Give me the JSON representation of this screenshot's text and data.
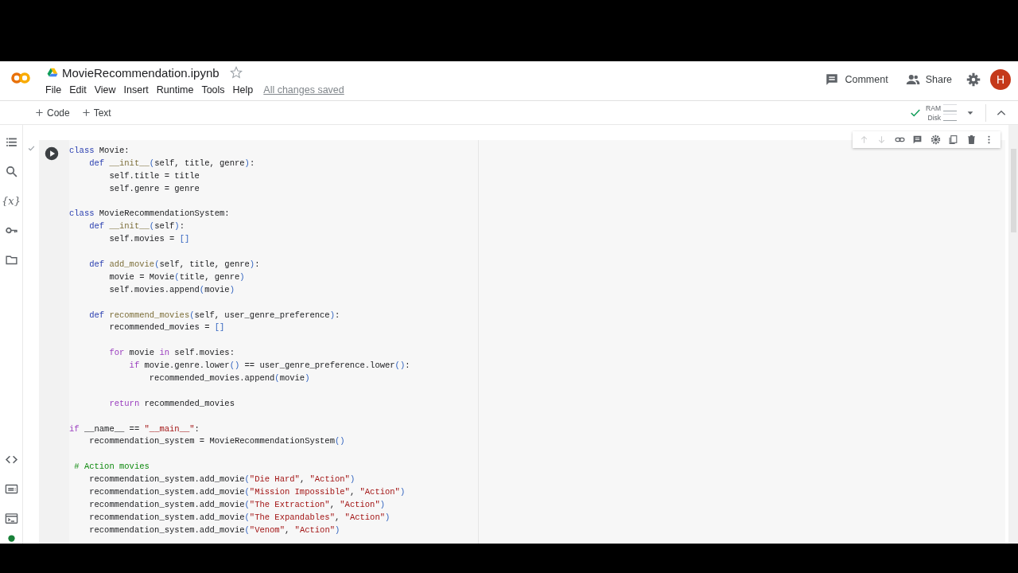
{
  "header": {
    "notebook_title": "MovieRecommendation.ipynb",
    "starred": false,
    "menu": [
      "File",
      "Edit",
      "View",
      "Insert",
      "Runtime",
      "Tools",
      "Help"
    ],
    "save_status": "All changes saved",
    "comment_label": "Comment",
    "share_label": "Share",
    "avatar_initial": "H"
  },
  "toolbar": {
    "add_buttons": [
      "Code",
      "Text"
    ],
    "resources": {
      "connected": true,
      "ram_label": "RAM",
      "disk_label": "Disk"
    }
  },
  "sidebar_items": [
    {
      "kind": "toc"
    },
    {
      "kind": "search"
    },
    {
      "kind": "variables",
      "glyph": "{x}"
    },
    {
      "kind": "secrets"
    },
    {
      "kind": "files"
    },
    {
      "kind": "snippets"
    },
    {
      "kind": "palette"
    },
    {
      "kind": "terminal"
    }
  ],
  "cell": {
    "executed": true,
    "toolbar": [
      {
        "kind": "up",
        "disabled": true
      },
      {
        "kind": "down",
        "disabled": true
      },
      {
        "kind": "link",
        "disabled": false
      },
      {
        "kind": "comment",
        "disabled": false
      },
      {
        "kind": "settings",
        "disabled": false
      },
      {
        "kind": "mirror",
        "disabled": false
      },
      {
        "kind": "delete",
        "disabled": false
      },
      {
        "kind": "more",
        "disabled": false
      }
    ],
    "lines": [
      {
        "kind": "code",
        "tokens": [
          {
            "kind": "kw",
            "text": "class"
          },
          {
            "kind": "p",
            "text": " Movie:"
          }
        ]
      },
      {
        "kind": "code",
        "tokens": [
          {
            "kind": "kw",
            "text": "    def"
          },
          {
            "kind": "fn",
            "text": " __init__"
          },
          {
            "kind": "br",
            "text": "("
          },
          {
            "kind": "p",
            "text": "self, title, genre"
          },
          {
            "kind": "br",
            "text": ")"
          },
          {
            "kind": "p",
            "text": ":"
          }
        ]
      },
      {
        "kind": "code",
        "tokens": [
          {
            "kind": "p",
            "text": "        self.title = title"
          }
        ]
      },
      {
        "kind": "code",
        "tokens": [
          {
            "kind": "p",
            "text": "        self.genre = genre"
          }
        ]
      },
      {
        "kind": "blank"
      },
      {
        "kind": "code",
        "tokens": [
          {
            "kind": "kw",
            "text": "class"
          },
          {
            "kind": "p",
            "text": " MovieRecommendationSystem:"
          }
        ]
      },
      {
        "kind": "code",
        "tokens": [
          {
            "kind": "kw",
            "text": "    def"
          },
          {
            "kind": "fn",
            "text": " __init__"
          },
          {
            "kind": "br",
            "text": "("
          },
          {
            "kind": "p",
            "text": "self"
          },
          {
            "kind": "br",
            "text": ")"
          },
          {
            "kind": "p",
            "text": ":"
          }
        ]
      },
      {
        "kind": "code",
        "tokens": [
          {
            "kind": "p",
            "text": "        self.movies = "
          },
          {
            "kind": "br",
            "text": "[]"
          }
        ]
      },
      {
        "kind": "blank"
      },
      {
        "kind": "code",
        "tokens": [
          {
            "kind": "kw",
            "text": "    def"
          },
          {
            "kind": "fn",
            "text": " add_movie"
          },
          {
            "kind": "br",
            "text": "("
          },
          {
            "kind": "p",
            "text": "self, title, genre"
          },
          {
            "kind": "br",
            "text": ")"
          },
          {
            "kind": "p",
            "text": ":"
          }
        ]
      },
      {
        "kind": "code",
        "tokens": [
          {
            "kind": "p",
            "text": "        movie = Movie"
          },
          {
            "kind": "br",
            "text": "("
          },
          {
            "kind": "p",
            "text": "title, genre"
          },
          {
            "kind": "br",
            "text": ")"
          }
        ]
      },
      {
        "kind": "code",
        "tokens": [
          {
            "kind": "p",
            "text": "        self.movies.append"
          },
          {
            "kind": "br",
            "text": "("
          },
          {
            "kind": "p",
            "text": "movie"
          },
          {
            "kind": "br",
            "text": ")"
          }
        ]
      },
      {
        "kind": "blank"
      },
      {
        "kind": "code",
        "tokens": [
          {
            "kind": "kw",
            "text": "    def"
          },
          {
            "kind": "fn",
            "text": " recommend_movies"
          },
          {
            "kind": "br",
            "text": "("
          },
          {
            "kind": "p",
            "text": "self, user_genre_preference"
          },
          {
            "kind": "br",
            "text": ")"
          },
          {
            "kind": "p",
            "text": ":"
          }
        ]
      },
      {
        "kind": "code",
        "tokens": [
          {
            "kind": "p",
            "text": "        recommended_movies = "
          },
          {
            "kind": "br",
            "text": "[]"
          }
        ]
      },
      {
        "kind": "blank"
      },
      {
        "kind": "code",
        "tokens": [
          {
            "kind": "ctl",
            "text": "        for"
          },
          {
            "kind": "p",
            "text": " movie "
          },
          {
            "kind": "ctl",
            "text": "in"
          },
          {
            "kind": "p",
            "text": " self.movies:"
          }
        ]
      },
      {
        "kind": "code",
        "tokens": [
          {
            "kind": "ctl",
            "text": "            if"
          },
          {
            "kind": "p",
            "text": " movie.genre.lower"
          },
          {
            "kind": "br",
            "text": "()"
          },
          {
            "kind": "p",
            "text": " == user_genre_preference.lower"
          },
          {
            "kind": "br",
            "text": "()"
          },
          {
            "kind": "p",
            "text": ":"
          }
        ]
      },
      {
        "kind": "code",
        "tokens": [
          {
            "kind": "p",
            "text": "                recommended_movies.append"
          },
          {
            "kind": "br",
            "text": "("
          },
          {
            "kind": "p",
            "text": "movie"
          },
          {
            "kind": "br",
            "text": ")"
          }
        ]
      },
      {
        "kind": "blank"
      },
      {
        "kind": "code",
        "tokens": [
          {
            "kind": "ctl",
            "text": "        return"
          },
          {
            "kind": "p",
            "text": " recommended_movies"
          }
        ]
      },
      {
        "kind": "blank"
      },
      {
        "kind": "code",
        "tokens": [
          {
            "kind": "ctl",
            "text": "if"
          },
          {
            "kind": "p",
            "text": " __name__ == "
          },
          {
            "kind": "str",
            "text": "\"__main__\""
          },
          {
            "kind": "p",
            "text": ":"
          }
        ]
      },
      {
        "kind": "code",
        "tokens": [
          {
            "kind": "p",
            "text": "    recommendation_system = MovieRecommendationSystem"
          },
          {
            "kind": "br",
            "text": "()"
          }
        ]
      },
      {
        "kind": "blank"
      },
      {
        "kind": "code",
        "tokens": [
          {
            "kind": "com",
            "text": " # Action movies"
          }
        ]
      },
      {
        "kind": "code",
        "tokens": [
          {
            "kind": "p",
            "text": "    recommendation_system.add_movie"
          },
          {
            "kind": "br",
            "text": "("
          },
          {
            "kind": "str",
            "text": "\"Die Hard\""
          },
          {
            "kind": "p",
            "text": ", "
          },
          {
            "kind": "str",
            "text": "\"Action\""
          },
          {
            "kind": "br",
            "text": ")"
          }
        ]
      },
      {
        "kind": "code",
        "tokens": [
          {
            "kind": "p",
            "text": "    recommendation_system.add_movie"
          },
          {
            "kind": "br",
            "text": "("
          },
          {
            "kind": "str",
            "text": "\"Mission Impossible\""
          },
          {
            "kind": "p",
            "text": ", "
          },
          {
            "kind": "str",
            "text": "\"Action\""
          },
          {
            "kind": "br",
            "text": ")"
          }
        ]
      },
      {
        "kind": "code",
        "tokens": [
          {
            "kind": "p",
            "text": "    recommendation_system.add_movie"
          },
          {
            "kind": "br",
            "text": "("
          },
          {
            "kind": "str",
            "text": "\"The Extraction\""
          },
          {
            "kind": "p",
            "text": ", "
          },
          {
            "kind": "str",
            "text": "\"Action\""
          },
          {
            "kind": "br",
            "text": ")"
          }
        ]
      },
      {
        "kind": "code",
        "tokens": [
          {
            "kind": "p",
            "text": "    recommendation_system.add_movie"
          },
          {
            "kind": "br",
            "text": "("
          },
          {
            "kind": "str",
            "text": "\"The Expandables\""
          },
          {
            "kind": "p",
            "text": ", "
          },
          {
            "kind": "str",
            "text": "\"Action\""
          },
          {
            "kind": "br",
            "text": ")"
          }
        ]
      },
      {
        "kind": "code",
        "tokens": [
          {
            "kind": "p",
            "text": "    recommendation_system.add_movie"
          },
          {
            "kind": "br",
            "text": "("
          },
          {
            "kind": "str",
            "text": "\"Venom\""
          },
          {
            "kind": "p",
            "text": ", "
          },
          {
            "kind": "str",
            "text": "\"Action\""
          },
          {
            "kind": "br",
            "text": ")"
          }
        ]
      }
    ]
  }
}
